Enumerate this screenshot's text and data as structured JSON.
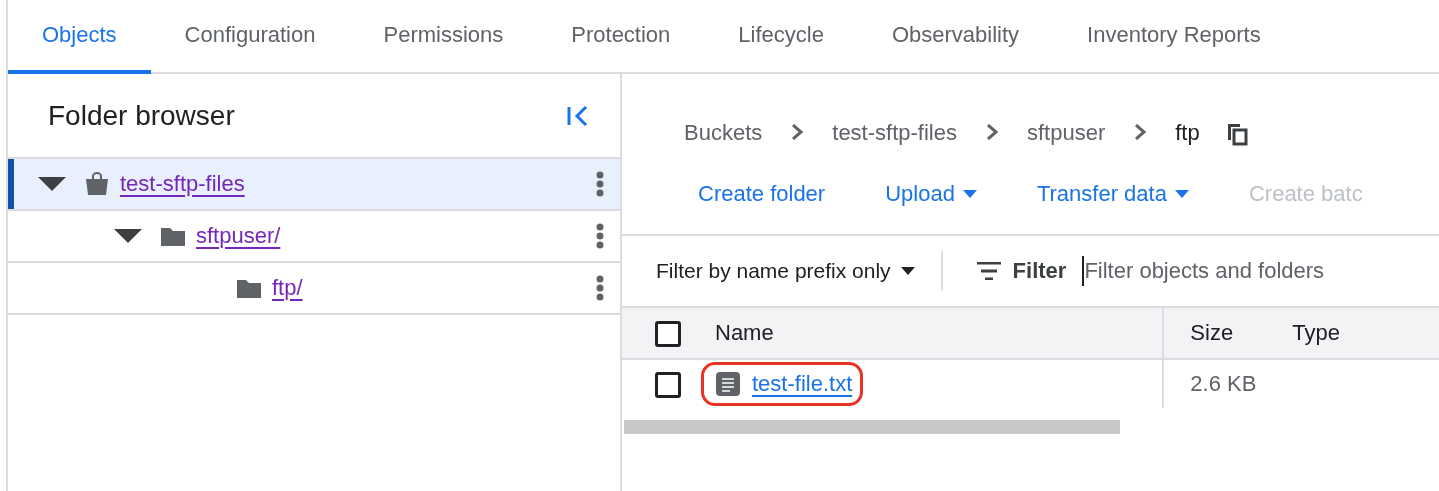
{
  "tabs": [
    {
      "label": "Objects",
      "selected": true
    },
    {
      "label": "Configuration",
      "selected": false
    },
    {
      "label": "Permissions",
      "selected": false
    },
    {
      "label": "Protection",
      "selected": false
    },
    {
      "label": "Lifecycle",
      "selected": false
    },
    {
      "label": "Observability",
      "selected": false
    },
    {
      "label": "Inventory Reports",
      "selected": false
    }
  ],
  "folder_browser": {
    "title": "Folder browser",
    "tree": [
      {
        "label": "test-sftp-files",
        "kind": "bucket",
        "expanded": true,
        "selected": true,
        "children": [
          {
            "label": "sftpuser/",
            "kind": "folder",
            "expanded": true,
            "selected": false,
            "children": [
              {
                "label": "ftp/",
                "kind": "folder",
                "selected": false
              }
            ]
          }
        ]
      }
    ]
  },
  "breadcrumb": [
    {
      "label": "Buckets",
      "current": false
    },
    {
      "label": "test-sftp-files",
      "current": false
    },
    {
      "label": "sftpuser",
      "current": false
    },
    {
      "label": "ftp",
      "current": true
    }
  ],
  "actions": [
    {
      "label": "Create folder",
      "dropdown": false,
      "disabled": false
    },
    {
      "label": "Upload",
      "dropdown": true,
      "disabled": false
    },
    {
      "label": "Transfer data",
      "dropdown": true,
      "disabled": false
    },
    {
      "label": "Create batc",
      "dropdown": false,
      "disabled": true
    }
  ],
  "filter": {
    "mode": "Filter by name prefix only",
    "label": "Filter",
    "placeholder": "Filter objects and folders"
  },
  "table": {
    "columns": [
      "Name",
      "Size",
      "Type"
    ],
    "header_checked": false,
    "rows": [
      {
        "name": "test-file.txt",
        "size": "2.6 KB",
        "checked": false,
        "highlighted": true
      }
    ]
  }
}
